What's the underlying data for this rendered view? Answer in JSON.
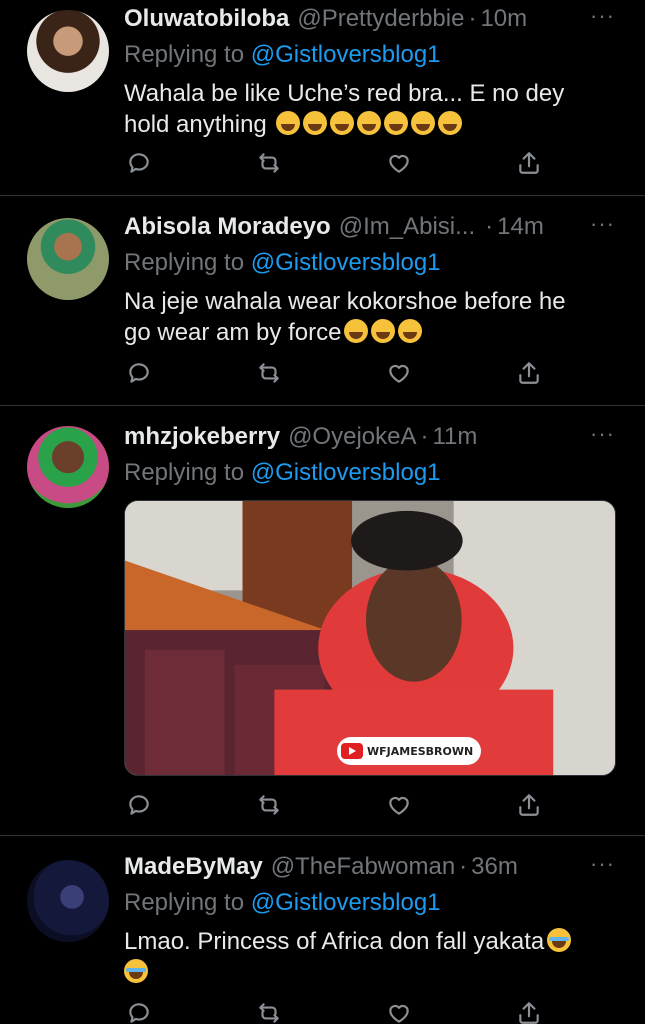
{
  "tweets": [
    {
      "name": "Oluwatobiloba",
      "handle": "@Prettyderbbie",
      "dot": "·",
      "time": "10m",
      "replying_prefix": "Replying to",
      "replying_to": "@Gistloversblog1",
      "text_line1": "Wahala be like Uche’s red bra... E no dey",
      "text_line2": "hold anything"
    },
    {
      "name": "Abisola Moradeyo",
      "handle": "@Im_Abisi...",
      "dot": "·",
      "time": "14m",
      "replying_prefix": "Replying to",
      "replying_to": "@Gistloversblog1",
      "text_line1": "Na jeje wahala wear kokorshoe  before he",
      "text_line2": "go wear am by force"
    },
    {
      "name": "mhzjokeberry",
      "handle": "@OyejokeA",
      "dot": "·",
      "time": "11m",
      "replying_prefix": "Replying to",
      "replying_to": "@Gistloversblog1",
      "media_watermark": "WFJAMESBROWN"
    },
    {
      "name": "MadeByMay",
      "handle": "@TheFabwoman",
      "dot": "·",
      "time": "36m",
      "replying_prefix": "Replying to",
      "replying_to": "@Gistloversblog1",
      "text_line1": "Lmao. Princess of Africa don fall yakata"
    }
  ],
  "more_label": "···",
  "icons": {
    "reply": "reply-icon",
    "retweet": "retweet-icon",
    "like": "heart-icon",
    "share": "share-icon",
    "emoji_laugh": "rolling-laughing-emoji",
    "emoji_cry": "tears-of-joy-cat-emoji"
  },
  "colors": {
    "background": "#000000",
    "text": "#e7e9ea",
    "muted": "#71767b",
    "link": "#1d9bf0",
    "divider": "#2f3336"
  }
}
